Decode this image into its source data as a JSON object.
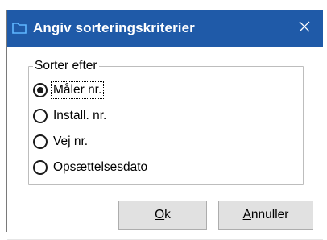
{
  "window": {
    "title": "Angiv sorteringskriterier",
    "titlebar_color": "#1f5aa8",
    "app_icon": "folder-icon",
    "close_icon": "close-icon"
  },
  "sort_group": {
    "label": "Sorter efter",
    "options": [
      {
        "label": "Måler nr.",
        "checked": true,
        "focused": true
      },
      {
        "label": "Install. nr.",
        "checked": false
      },
      {
        "label": "Vej nr.",
        "checked": false
      },
      {
        "label": "Opsættelsesdato",
        "checked": false
      }
    ]
  },
  "buttons": {
    "ok": {
      "mnemonic": "O",
      "rest": "k"
    },
    "cancel": {
      "mnemonic": "A",
      "rest": "nnuller"
    }
  }
}
